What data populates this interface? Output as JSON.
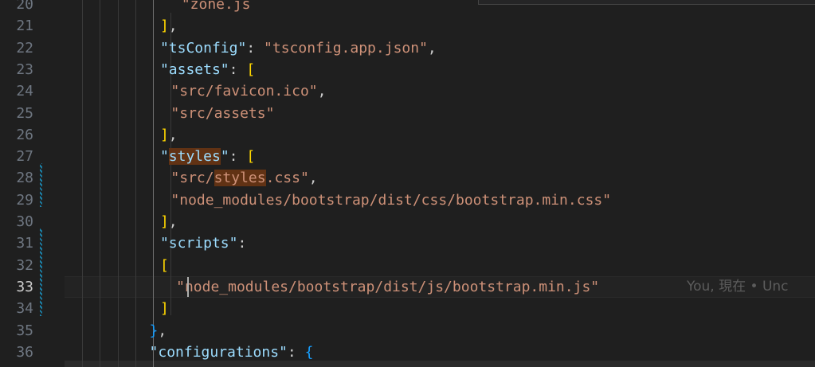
{
  "editor": {
    "lines": [
      {
        "num": "20",
        "indent": 11,
        "tokens": [
          {
            "t": "\"zone.js",
            "c": "str"
          }
        ]
      },
      {
        "num": "21",
        "indent": 9,
        "tokens": [
          {
            "t": "]",
            "c": "b1"
          },
          {
            "t": ",",
            "c": "punc"
          }
        ]
      },
      {
        "num": "22",
        "indent": 9,
        "tokens": [
          {
            "t": "\"tsConfig\"",
            "c": "key"
          },
          {
            "t": ": ",
            "c": "punc"
          },
          {
            "t": "\"tsconfig.app.json\"",
            "c": "str"
          },
          {
            "t": ",",
            "c": "punc"
          }
        ]
      },
      {
        "num": "23",
        "indent": 9,
        "tokens": [
          {
            "t": "\"assets\"",
            "c": "key"
          },
          {
            "t": ": ",
            "c": "punc"
          },
          {
            "t": "[",
            "c": "b1"
          }
        ]
      },
      {
        "num": "24",
        "indent": 10,
        "tokens": [
          {
            "t": "\"src/favicon.ico\"",
            "c": "str"
          },
          {
            "t": ",",
            "c": "punc"
          }
        ]
      },
      {
        "num": "25",
        "indent": 10,
        "tokens": [
          {
            "t": "\"src/assets\"",
            "c": "str"
          }
        ]
      },
      {
        "num": "26",
        "indent": 9,
        "tokens": [
          {
            "t": "]",
            "c": "b1"
          },
          {
            "t": ",",
            "c": "punc"
          }
        ]
      },
      {
        "num": "27",
        "indent": 9,
        "tokens": [
          {
            "t": "\"",
            "c": "key"
          },
          {
            "t": "styles",
            "c": "key hl"
          },
          {
            "t": "\"",
            "c": "key"
          },
          {
            "t": ": ",
            "c": "punc"
          },
          {
            "t": "[",
            "c": "b1"
          }
        ]
      },
      {
        "num": "28",
        "indent": 10,
        "tokens": [
          {
            "t": "\"src/",
            "c": "str"
          },
          {
            "t": "styles",
            "c": "str hl"
          },
          {
            "t": ".css\"",
            "c": "str"
          },
          {
            "t": ",",
            "c": "punc"
          }
        ]
      },
      {
        "num": "29",
        "indent": 10,
        "tokens": [
          {
            "t": "\"node_modules/bootstrap/dist/css/bootstrap.min.css\"",
            "c": "str"
          }
        ]
      },
      {
        "num": "30",
        "indent": 9,
        "tokens": [
          {
            "t": "]",
            "c": "b1"
          },
          {
            "t": ",",
            "c": "punc"
          }
        ]
      },
      {
        "num": "31",
        "indent": 9,
        "tokens": [
          {
            "t": "\"scripts\"",
            "c": "key"
          },
          {
            "t": ":",
            "c": "punc"
          }
        ]
      },
      {
        "num": "32",
        "indent": 9,
        "tokens": [
          {
            "t": "[",
            "c": "b1"
          }
        ]
      },
      {
        "num": "33",
        "indent": 10.5,
        "current": true,
        "tokens": [
          {
            "t": "\"node_modules/bootstrap/dist/js/bootstrap.min.js\"",
            "c": "str"
          }
        ],
        "blame": "You, 現在 • Unc"
      },
      {
        "num": "34",
        "indent": 9,
        "tokens": [
          {
            "t": "]",
            "c": "b1"
          }
        ]
      },
      {
        "num": "35",
        "indent": 8,
        "tokens": [
          {
            "t": "}",
            "c": "b3"
          },
          {
            "t": ",",
            "c": "punc"
          }
        ]
      },
      {
        "num": "36",
        "indent": 8,
        "tokens": [
          {
            "t": "\"configurations\"",
            "c": "key"
          },
          {
            "t": ": ",
            "c": "punc"
          },
          {
            "t": "{",
            "c": "b3"
          }
        ]
      }
    ]
  }
}
